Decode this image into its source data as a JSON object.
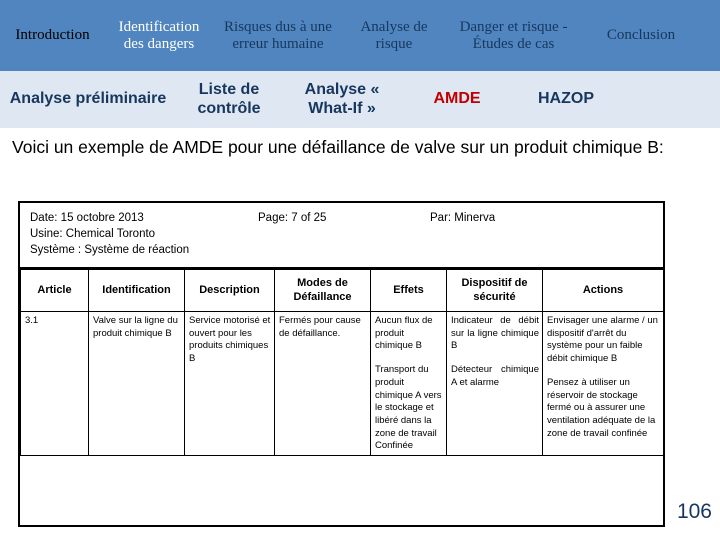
{
  "nav": {
    "row1": [
      {
        "label": "Introduction",
        "color": "#000000",
        "width": 105
      },
      {
        "label": "Identification des dangers",
        "color": "#ffffff",
        "width": 108
      },
      {
        "label": "Risques dus à une erreur humaine",
        "color": "#17375e",
        "width": 130
      },
      {
        "label": "Analyse de risque",
        "color": "#17375e",
        "width": 102
      },
      {
        "label": "Danger et risque - Études de cas",
        "color": "#17375e",
        "width": 137
      },
      {
        "label": "Conclusion",
        "color": "#17375e",
        "width": 118
      }
    ],
    "row2": [
      {
        "label": "Analyse préliminaire",
        "color": "#17375e",
        "width": 176
      },
      {
        "label": "Liste de contrôle",
        "color": "#17375e",
        "width": 106
      },
      {
        "label": "Analyse « What-If »",
        "color": "#17375e",
        "width": 120
      },
      {
        "label": "AMDE",
        "color": "#c00000",
        "width": 110
      },
      {
        "label": "HAZOP",
        "color": "#17375e",
        "width": 108
      }
    ]
  },
  "intro": {
    "text": "Voici un exemple de AMDE pour une défaillance de valve sur un produit chimique B:"
  },
  "sheet": {
    "meta": {
      "date": "Date: 15 octobre 2013",
      "page": "Page: 7 of 25",
      "by": "Par: Minerva",
      "plant": "Usine: Chemical Toronto",
      "system": "Système : Système de réaction"
    },
    "columns": [
      "Article",
      "Identification",
      "Description",
      "Modes de Défaillance",
      "Effets",
      "Dispositif de sécurité",
      "Actions"
    ],
    "rows": [
      {
        "article": "3.1",
        "identification": "Valve sur la ligne du produit chimique B",
        "description": "Service motorisé et ouvert pour les produits chimiques B",
        "modes": "Fermés pour cause de défaillance.",
        "effets_1": "Aucun flux de produit chimique B",
        "effets_2": "Transport du produit chimique A vers le stockage et libéré dans la zone de travail Confinée",
        "dispositif_1": "Indicateur de débit sur la ligne chimique B",
        "dispositif_2": "Détecteur chimique A et alarme",
        "actions_1": "Envisager une alarme / un dispositif d'arrêt du système pour un faible débit chimique B",
        "actions_2": "Pensez à utiliser un réservoir de stockage fermé ou à assurer une ventilation adéquate de la zone de travail confinée"
      }
    ]
  },
  "footer": {
    "page_number": "106"
  }
}
